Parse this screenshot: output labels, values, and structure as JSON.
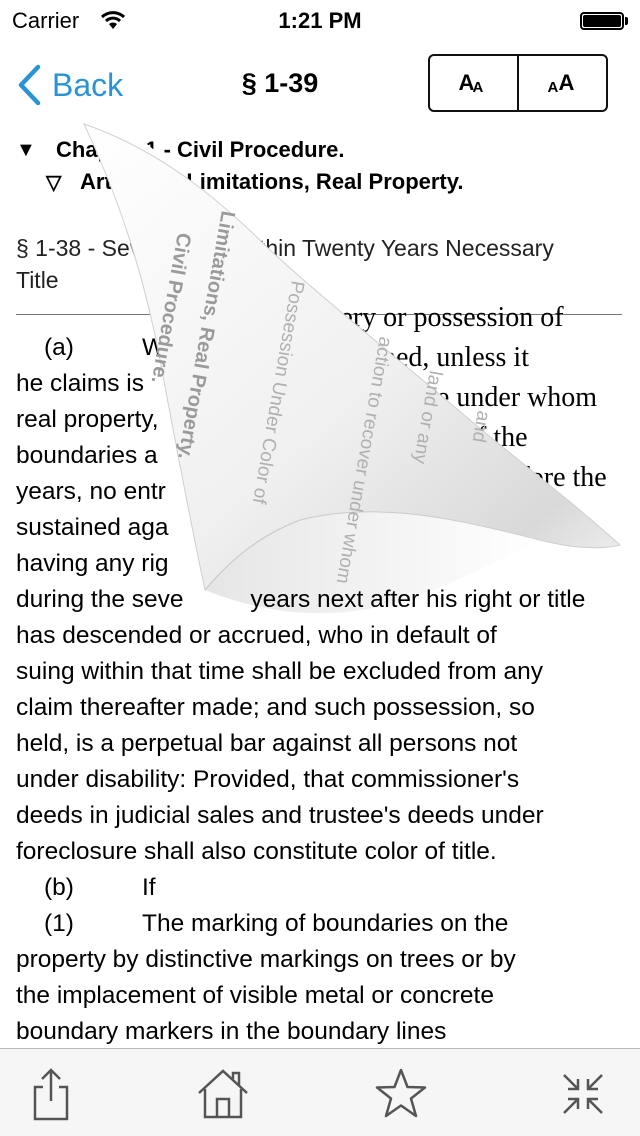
{
  "status": {
    "carrier": "Carrier",
    "time": "1:21 PM"
  },
  "nav": {
    "back_label": "Back",
    "title": "§ 1-39",
    "font_decrease_big": "A",
    "font_decrease_small": "A",
    "font_increase_small": "A",
    "font_increase_big": "A"
  },
  "tree": {
    "chapter": "Chapter 1 - Civil Procedure.",
    "article": "Article 4 - Limitations, Real Property.",
    "arrow_down_filled": "▼",
    "arrow_down_outline": "▽"
  },
  "previous_section": "§ 1-38 - Seven Years within Twenty Years Necessary Title",
  "body": {
    "a_label": "(a)",
    "a_text_start": "W",
    "partial_lines": [
      "covery or possession of",
      "ntained, unless it",
      "hose under whom",
      "d of the",
      "before the",
      "was"
    ],
    "left_lines": [
      "he claims is",
      "real property,",
      "boundaries a",
      "years, no entr",
      "sustained aga",
      "having any rig",
      "during the seve"
    ],
    "lines_after": [
      "years next after his right or title",
      "has descended or accrued, who in default of",
      "suing within that time shall be excluded from any",
      "claim thereafter made; and such possession, so",
      "held, is a perpetual bar against all persons not",
      "under disability: Provided, that commissioner's",
      "deeds in judicial sales and trustee's deeds under",
      "foreclosure shall also constitute color of title."
    ],
    "b_label": "(b)",
    "b_text": "If",
    "one_label": "(1)",
    "one_text": "The marking of boundaries on the",
    "closing_lines": [
      "property by distinctive markings on trees or by",
      "the implacement of visible metal or concrete",
      "boundary markers in the boundary lines"
    ]
  },
  "curl_back_text": [
    "Civil Procedure.",
    "Limitations, Real Property.",
    "Possession Under Color of",
    "action to recover under whom",
    "land or any",
    "and"
  ],
  "colors": {
    "accent": "#2a93d5",
    "toolbar_bg": "#f6f6f6",
    "icon": "#555555"
  },
  "toolbar": {
    "icons": [
      "share-icon",
      "home-icon",
      "star-icon",
      "collapse-icon"
    ]
  }
}
